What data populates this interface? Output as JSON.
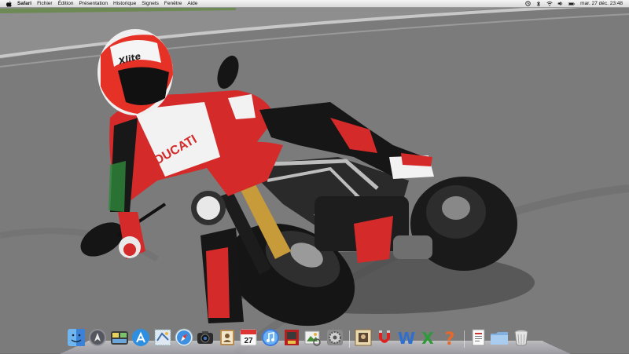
{
  "menubar": {
    "app_name": "Safari",
    "menus": [
      "Fichier",
      "Édition",
      "Présentation",
      "Historique",
      "Signets",
      "Fenêtre",
      "Aide"
    ],
    "clock": "mar. 27 déc.  23:48",
    "status_icons": [
      "time-machine-icon",
      "bluetooth-icon",
      "wifi-icon",
      "volume-icon",
      "battery-icon"
    ]
  },
  "wallpaper": {
    "description_icon": "motorcycle-wallpaper-image",
    "helmet_brand": "Xlite",
    "suit_text": "DUCATI",
    "colors": {
      "red": "#d42a2a",
      "black": "#141414",
      "white": "#f2f2f2",
      "asphalt": "#777777"
    }
  },
  "dock": {
    "items": [
      {
        "name": "finder-icon"
      },
      {
        "name": "launchpad-icon"
      },
      {
        "name": "dashboard-icon"
      },
      {
        "name": "app-store-icon"
      },
      {
        "name": "mail-stamp-icon"
      },
      {
        "name": "safari-icon"
      },
      {
        "name": "iphoto-camera-icon"
      },
      {
        "name": "address-book-icon"
      },
      {
        "name": "ical-icon",
        "text": "27"
      },
      {
        "name": "itunes-icon"
      },
      {
        "name": "photo-booth-icon"
      },
      {
        "name": "preview-icon"
      },
      {
        "name": "system-preferences-icon"
      },
      {
        "name": "photo-frame-icon"
      },
      {
        "name": "magnet-icon"
      },
      {
        "name": "word-icon",
        "text": "W"
      },
      {
        "name": "excel-icon",
        "text": "X"
      },
      {
        "name": "help-icon",
        "text": "?"
      },
      {
        "name": "documents-stack-icon"
      },
      {
        "name": "applications-folder-icon"
      },
      {
        "name": "trash-icon"
      }
    ]
  }
}
